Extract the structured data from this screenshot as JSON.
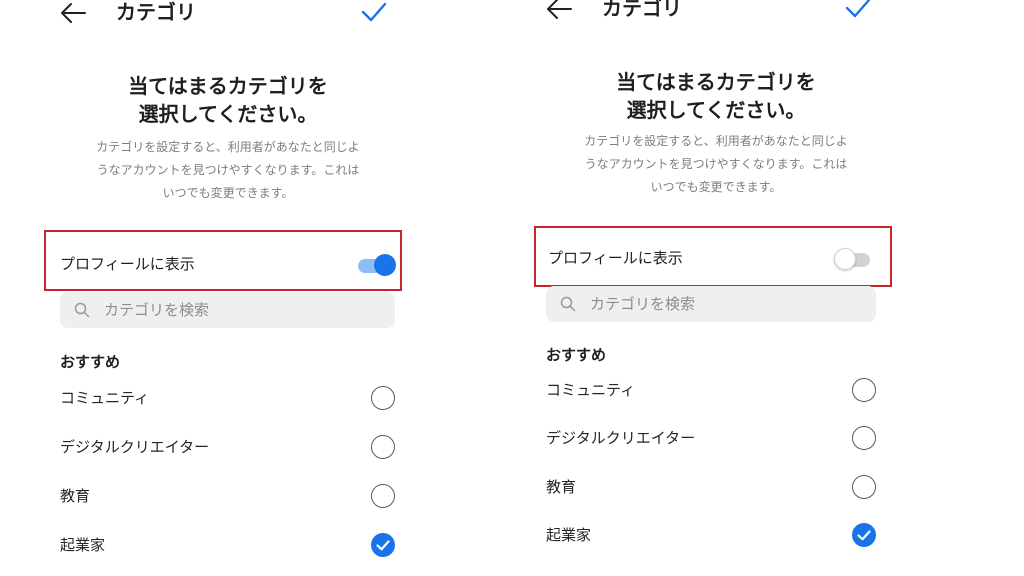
{
  "header": {
    "title": "カテゴリ"
  },
  "heading": {
    "line1": "当てはまるカテゴリを",
    "line2": "選択してください。"
  },
  "description": {
    "line1": "カテゴリを設定すると、利用者があなたと同じよ",
    "line2": "うなアカウントを見つけやすくなります。これは",
    "line3": "いつでも変更できます。"
  },
  "display_toggle": {
    "label": "プロフィールに表示"
  },
  "search": {
    "placeholder": "カテゴリを検索"
  },
  "section": {
    "label": "おすすめ"
  },
  "categories": [
    {
      "label": "コミュニティ",
      "selected": false
    },
    {
      "label": "デジタルクリエイター",
      "selected": false
    },
    {
      "label": "教育",
      "selected": false
    },
    {
      "label": "起業家",
      "selected": true
    }
  ],
  "panels": [
    {
      "toggle_on": true
    },
    {
      "toggle_on": false
    }
  ],
  "colors": {
    "accent": "#1a73e8",
    "highlight_border": "#c1272d",
    "muted_text": "#7d7d7d"
  }
}
